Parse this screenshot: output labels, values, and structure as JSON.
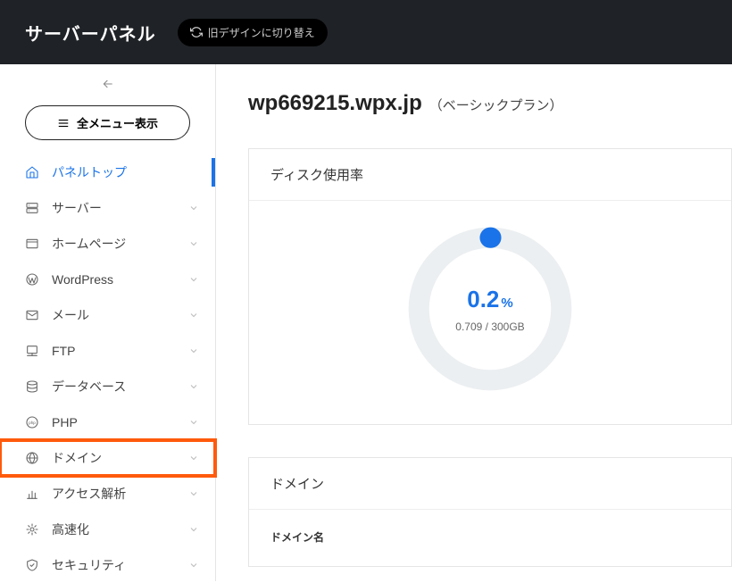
{
  "header": {
    "title": "サーバーパネル",
    "theme_toggle_label": "旧デザインに切り替え"
  },
  "sidebar": {
    "all_menu_label": "全メニュー表示",
    "items": [
      {
        "icon": "home",
        "label": "パネルトップ",
        "expandable": false,
        "active": true,
        "highlighted": false
      },
      {
        "icon": "server",
        "label": "サーバー",
        "expandable": true,
        "active": false,
        "highlighted": false
      },
      {
        "icon": "window",
        "label": "ホームページ",
        "expandable": true,
        "active": false,
        "highlighted": false
      },
      {
        "icon": "wp",
        "label": "WordPress",
        "expandable": true,
        "active": false,
        "highlighted": false
      },
      {
        "icon": "mail",
        "label": "メール",
        "expandable": true,
        "active": false,
        "highlighted": false
      },
      {
        "icon": "ftp",
        "label": "FTP",
        "expandable": true,
        "active": false,
        "highlighted": false
      },
      {
        "icon": "db",
        "label": "データベース",
        "expandable": true,
        "active": false,
        "highlighted": false
      },
      {
        "icon": "php",
        "label": "PHP",
        "expandable": true,
        "active": false,
        "highlighted": false
      },
      {
        "icon": "globe",
        "label": "ドメイン",
        "expandable": true,
        "active": false,
        "highlighted": true
      },
      {
        "icon": "chart",
        "label": "アクセス解析",
        "expandable": true,
        "active": false,
        "highlighted": false
      },
      {
        "icon": "speed",
        "label": "高速化",
        "expandable": true,
        "active": false,
        "highlighted": false
      },
      {
        "icon": "shield",
        "label": "セキュリティ",
        "expandable": true,
        "active": false,
        "highlighted": false
      }
    ]
  },
  "main": {
    "page_title": "wp669215.wpx.jp",
    "page_subtitle": "（ベーシックプラン）",
    "disk_card": {
      "title": "ディスク使用率",
      "percent_value": "0.2",
      "percent_unit": "%",
      "detail": "0.709 / 300GB"
    },
    "domain_card": {
      "title": "ドメイン",
      "column_header": "ドメイン名"
    }
  },
  "chart_data": {
    "type": "pie",
    "title": "ディスク使用率",
    "slices": [
      {
        "name": "used",
        "value": 0.2
      },
      {
        "name": "free",
        "value": 99.8
      }
    ],
    "center_label": "0.2%",
    "subtitle": "0.709 / 300GB"
  }
}
